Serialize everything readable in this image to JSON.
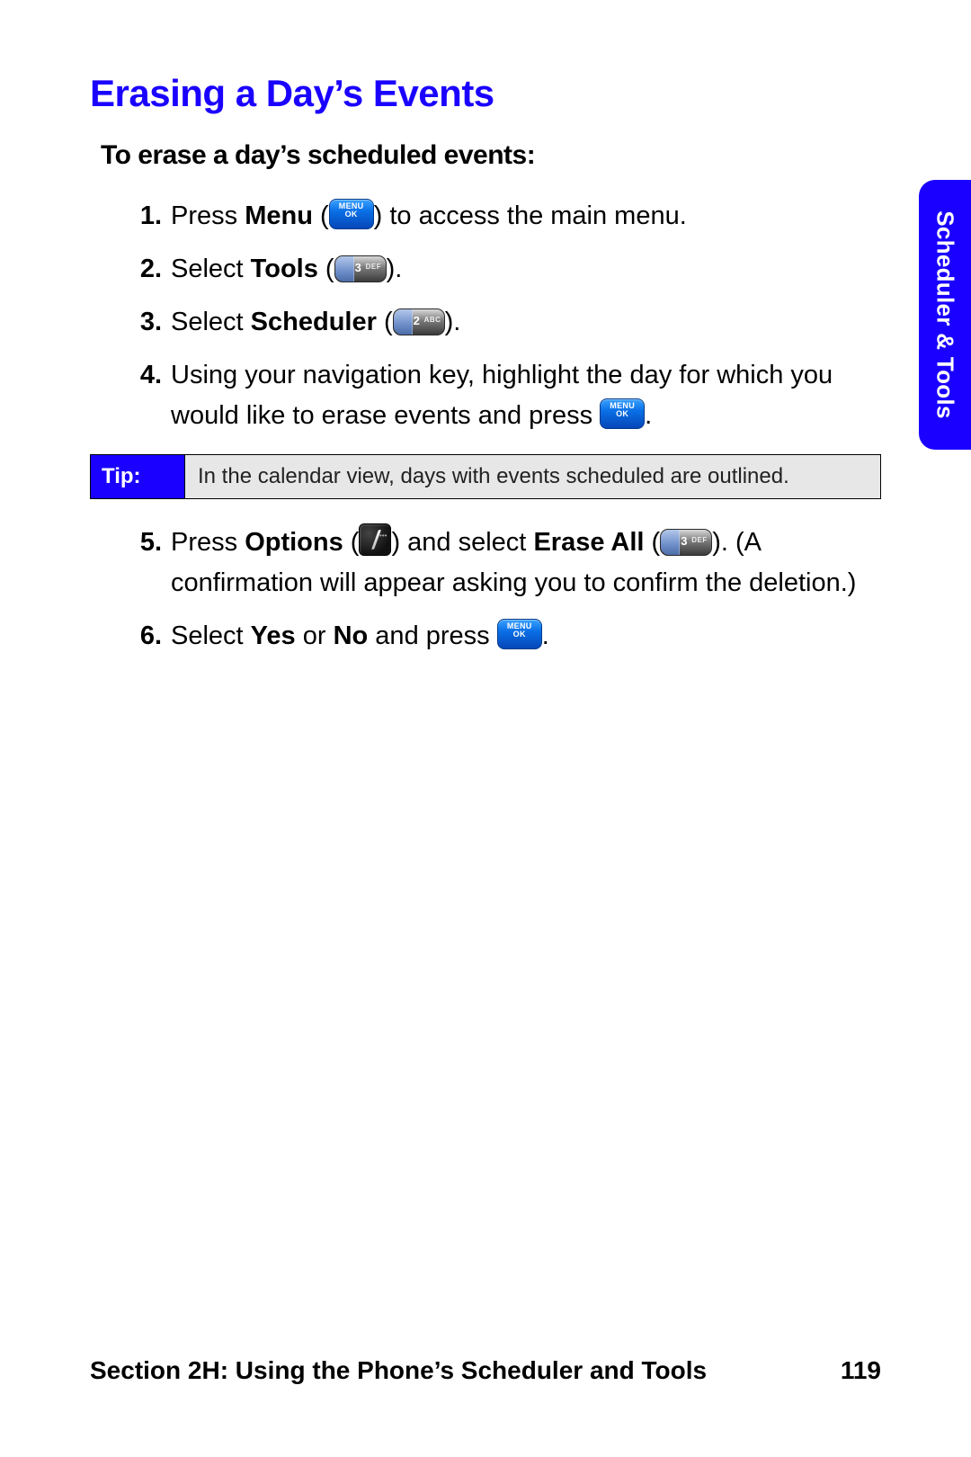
{
  "heading": "Erasing a Day’s Events",
  "subheading": "To erase a day’s scheduled events:",
  "steps": {
    "s1": {
      "num": "1.",
      "pre": "Press ",
      "bold1": "Menu",
      "mid": " (",
      "post": ") to access the main menu."
    },
    "s2": {
      "num": "2.",
      "pre": "Select ",
      "bold1": "Tools",
      "mid": " (",
      "post": ").",
      "key_digit": "3",
      "key_letters": "DEF"
    },
    "s3": {
      "num": "3.",
      "pre": "Select ",
      "bold1": "Scheduler",
      "mid": " (",
      "post": ").",
      "key_digit": "2",
      "key_letters": "ABC"
    },
    "s4": {
      "num": "4.",
      "text_a": "Using your navigation key, highlight the day for which you would like to erase events and press ",
      "text_b": "."
    },
    "s5": {
      "num": "5.",
      "pre": "Press ",
      "bold1": "Options",
      "mid1": " (",
      "mid2": ") and select ",
      "bold2": "Erase All",
      "mid3": " (",
      "post": "). (A confirmation will appear asking you to confirm the deletion.)",
      "key_digit": "3",
      "key_letters": "DEF"
    },
    "s6": {
      "num": "6.",
      "pre": "Select ",
      "bold1": "Yes",
      "mid": " or ",
      "bold2": "No",
      "mid2": " and press ",
      "post": "."
    }
  },
  "tip": {
    "label": "Tip:",
    "body": "In the calendar view, days with events scheduled are outlined."
  },
  "sidetab": "Scheduler & Tools",
  "footer": {
    "section": "Section 2H: Using the Phone’s Scheduler and Tools",
    "page": "119"
  }
}
